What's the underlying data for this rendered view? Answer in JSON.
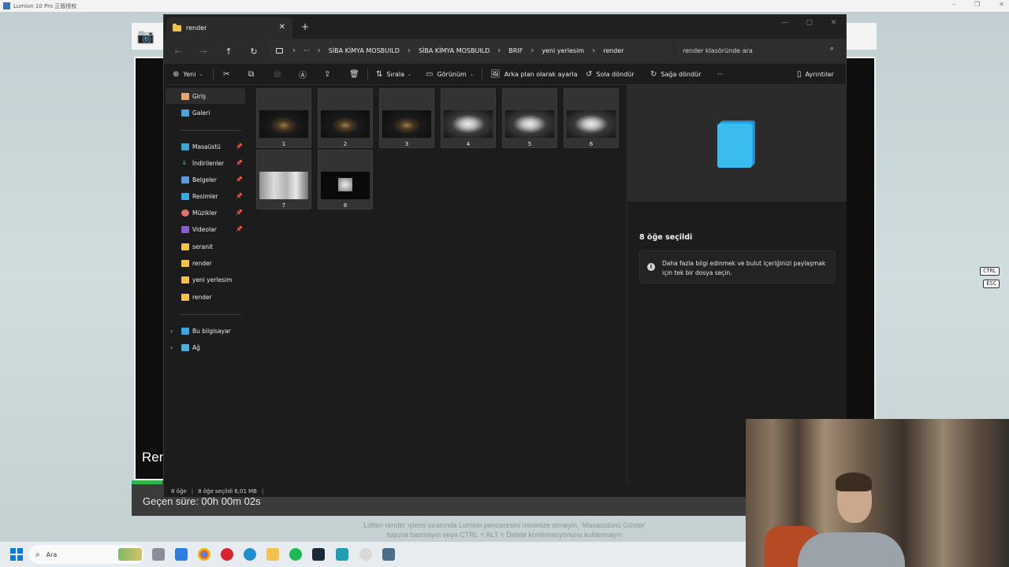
{
  "lumion": {
    "window_title": "Lumion 10 Pro 正版授权",
    "render_label": "Ren",
    "elapsed": "Geçen süre: 00h 00m 02s",
    "notice_line1": "Lütfen render işlemi sırasında Lumion penceresini minimize etmeyin, 'Masaüstünü Göster'",
    "notice_line2": "tuşuna basmayın veya CTRL + ALT + Delete kombinasyonunu kullanmayın",
    "key_ctrl": "CTRL",
    "key_esc": "ESC",
    "progress_fraction": 0.05
  },
  "explorer": {
    "tab_title": "render",
    "address": {
      "ellipsis": "···",
      "crumbs": [
        "SİBA KİMYA MOSBUILD",
        "SİBA KİMYA MOSBUILD",
        "BRIF",
        "yeni yerlesim",
        "render"
      ]
    },
    "search_placeholder": "render klasöründe ara",
    "commands": {
      "new": "Yeni",
      "sort": "Sırala",
      "view": "Görünüm",
      "set_background": "Arka plan olarak ayarla",
      "rotate_left": "Sola döndür",
      "rotate_right": "Sağa döndür",
      "more": "···",
      "details": "Ayrıntılar"
    },
    "sidebar": {
      "home": "Giriş",
      "gallery": "Galeri",
      "desktop": "Masaüstü",
      "downloads": "İndirilenler",
      "documents": "Belgeler",
      "pictures": "Resimler",
      "music": "Müzikler",
      "videos": "Videolar",
      "folder1": "seranit",
      "folder2": "render",
      "folder3": "yeni yerlesim",
      "folder4": "render",
      "this_pc": "Bu bilgisayar",
      "network": "Ağ"
    },
    "files": [
      "1",
      "2",
      "3",
      "4",
      "5",
      "6",
      "7",
      "8"
    ],
    "details_pane": {
      "selection_title": "8 öğe seçildi",
      "info_text": "Daha fazla bilgi edinmek ve bulut içeriğinizi paylaşmak için tek bir dosya seçin."
    },
    "status": {
      "count": "8 öğe",
      "selected": "8 öğe seçildi  6,01 MB"
    }
  },
  "taskbar": {
    "search_label": "Ara"
  },
  "colors": {
    "accent": "#0a7ad8",
    "folder": "#f2c14e",
    "progress": "#2fb54a",
    "explorer_bg": "#1c1c1c"
  }
}
